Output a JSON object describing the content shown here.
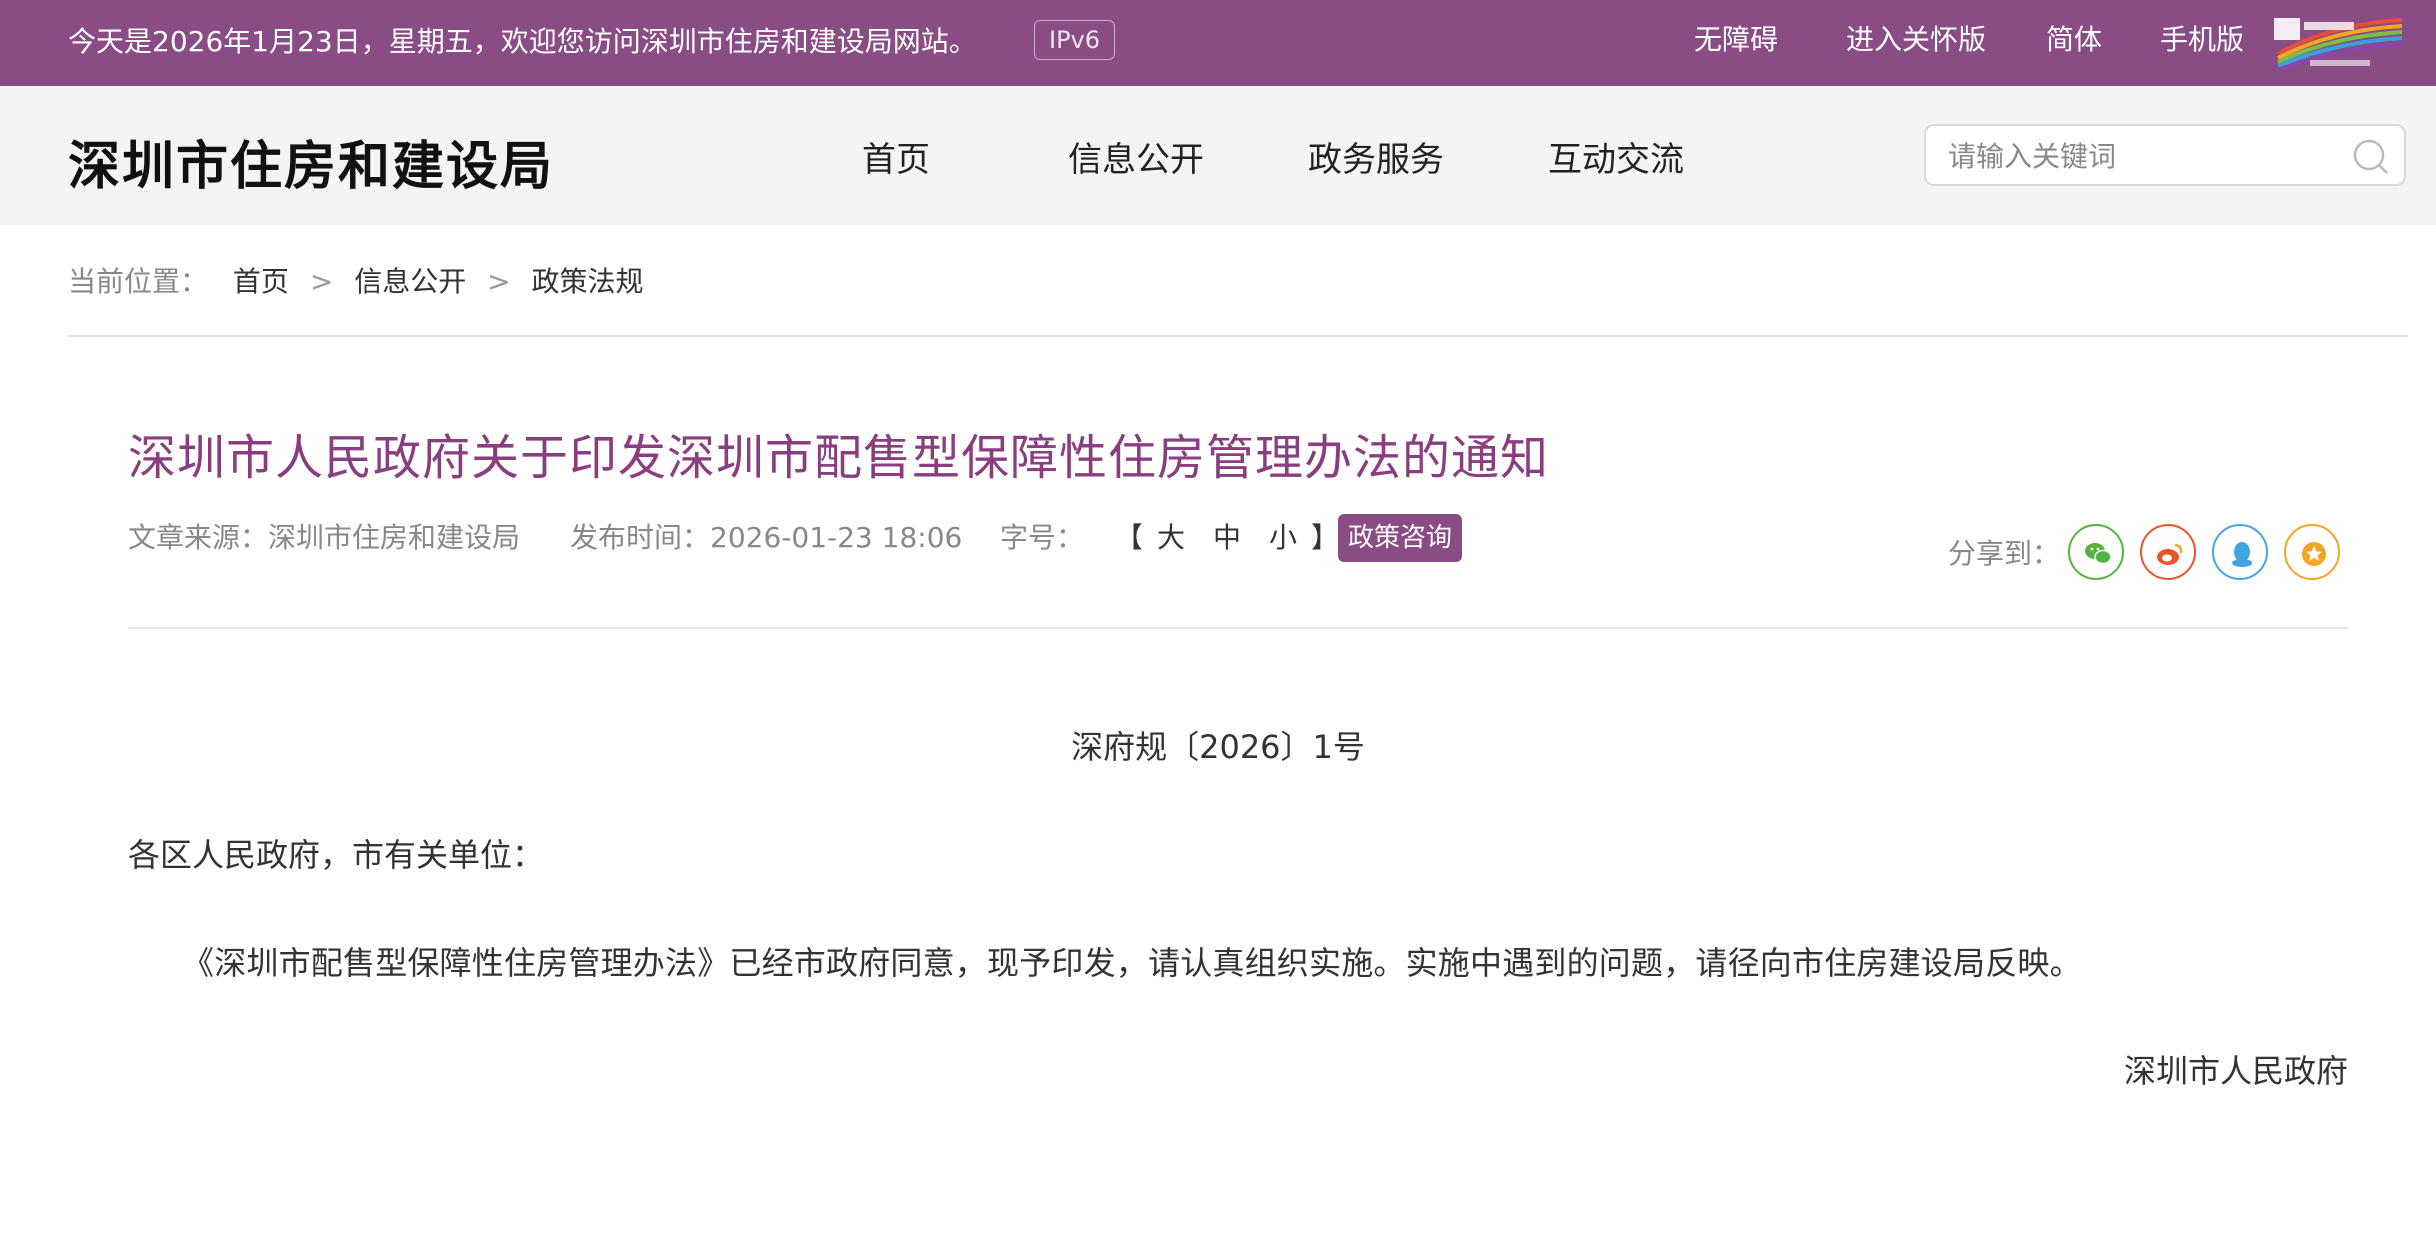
{
  "topbar": {
    "welcome": "今天是2026年1月23日，星期五，欢迎您访问深圳市住房和建设局网站。",
    "ipv6_badge": "IPv6",
    "links": [
      "无障碍",
      "进入关怀版",
      "简体",
      "手机版"
    ],
    "logo_icon": "shenzhen-china-logo"
  },
  "header": {
    "site_name": "深圳市住房和建设局",
    "nav": [
      "首页",
      "信息公开",
      "政务服务",
      "互动交流"
    ],
    "search": {
      "placeholder": "请输入关键词",
      "value": "",
      "icon": "search-icon"
    }
  },
  "breadcrumb": {
    "label": "当前位置：",
    "items": [
      "首页",
      "信息公开",
      "政策法规"
    ],
    "separator": ">"
  },
  "article": {
    "title": "深圳市人民政府关于印发深圳市配售型保障性住房管理办法的通知",
    "source_label": "文章来源：",
    "source": "深圳市住房和建设局",
    "date_label": "发布时间：",
    "date": "2026-01-23 18:06",
    "font_size_label": "字号：",
    "font_sizes": [
      "大",
      "中",
      "小"
    ],
    "bracket_open": "【",
    "bracket_close": "】",
    "consult_button": "政策咨询",
    "share_label": "分享到：",
    "share_icons": [
      "wechat-icon",
      "weibo-icon",
      "qq-icon",
      "favorite-icon"
    ],
    "doc_number": "深府规〔2026〕1号",
    "salutation": "各区人民政府，市有关单位：",
    "body": "《深圳市配售型保障性住房管理办法》已经市政府同意，现予印发，请认真组织实施。实施中遇到的问题，请径向市住房建设局反映。",
    "signature": "深圳市人民政府"
  },
  "colors": {
    "brand_purple": "#8a4c84",
    "title_purple": "#8a3e80",
    "wechat": "#52b440",
    "weibo": "#e8542c",
    "qq": "#43a4e0",
    "favorite": "#f3a625"
  }
}
